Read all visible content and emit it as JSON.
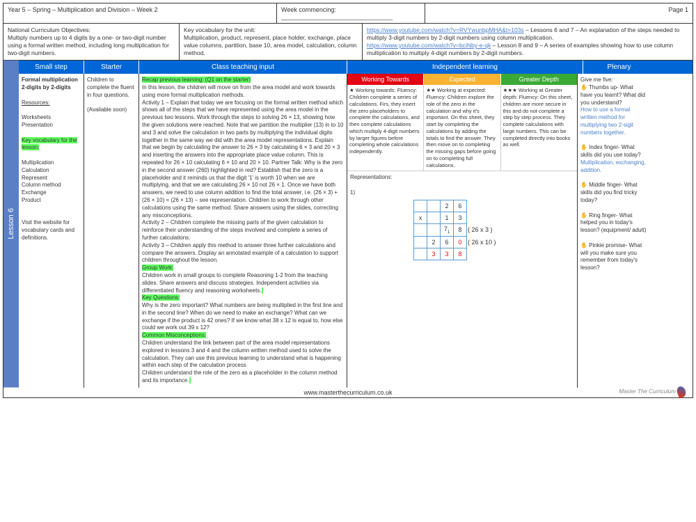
{
  "header": {
    "title": "Year 5 – Spring – Multiplication and Division – Week 2",
    "week": "Week commencing: ________________________________",
    "page": "Page 1"
  },
  "objectives": {
    "label": "National Curriculum Objectives:",
    "text": "Multiply numbers up to 4 digits by a one- or two-digit number using a formal written method, including long multiplication for two-digit numbers."
  },
  "vocab": {
    "label": "Key vocabulary for the unit:",
    "text": "Multiplication, product, represent, place holder, exchange, place value columns, partition, base 10,  area model,  calculation, column method."
  },
  "links": {
    "l1": "https://www.youtube.com/watch?v=RVYwunbpMHA&t=103s",
    "l1t": " – Lessons 6 and 7 – An explanation of the steps needed to multiply 3-digit numbers by 2-digit numbers using column multiplication.",
    "l2": "https://www.youtube.com/watch?v=bciNby-e-qk",
    "l2t": " – Lesson 8 and 9 – A series of examples showing how to use column multiplication to multiply 4-digit numbers by 2-digit numbers."
  },
  "lesson": "Lesson 6",
  "cols": {
    "c1": "Small step",
    "c2": "Starter",
    "c3": "Class teaching input",
    "c4": "Independent learning",
    "c5": "Plenary"
  },
  "smallstep": {
    "title": "Formal multiplication 2-digits by 2-digits",
    "res": "Resources:",
    "res1": "Worksheets",
    "res2": "Presentation",
    "kv": "Key vocabulary for the lesson:",
    "kvlist": "Multiplication\nCalculation\nRepresent\nColumn method\nExchange\nProduct",
    "note": "Visit the website for vocabulary cards and definitions."
  },
  "starter": {
    "text": "Children to complete the fluent in four questions.",
    "note": "(Available soon)"
  },
  "input": {
    "recap": "Recap previous learning: (Q1 on the starter)",
    "p1": "In this lesson, the children will move on from the area model and work towards using more formal multiplication methods.",
    "p2": "Activity 1 – Explain that today we are focusing on the formal written method which shows all of the steps that we have represented using the area model in the previous two lessons. Work through the steps to solving 26 × 13, showing how the given solutions were reached. Note that we partition the multiplier (13) in to 10 and 3 and solve the calculation in two parts by multiplying the individual digits together in the same way we did with the area model representations. Explain that we begin by calculating the answer to 26 × 3 by calculating 6 × 3 and 20 × 3 and inserting the answers into the appropriate place value column. This is repeated for 26 × 10 calculating 6 × 10 and 20 × 10. Partner Talk: Why is the zero in the second answer (260) highlighted in red? Establish that the zero is a placeholder and it reminds us that the digit '1' is worth 10 when we are multiplying, and that we are calculating 26 × 10 not 26 × 1. Once we have both answers, we need to use column addition to find the total answer, i.e. (26 × 3) + (26 × 10) = (26 × 13) – see representation. Children to work through other calculations using the same method. Share answers  using the slides, correcting any misconceptions.",
    "p3": "Activity 2 – Children complete the missing parts of the given calculation to reinforce their understanding of the steps involved and complete a series of further calculations.",
    "p4": "Activity 3 – Children apply this method to answer three further calculations and compare the answers. Display an annotated example of a calculation to support children throughout the lesson.",
    "gw": "Group Work:",
    "gwt": "Children work in small groups to complete Reasoning 1-2 from the teaching slides. Share answers and discuss strategies. Independent activities via differentiated fluency and reasoning worksheets.",
    "kq": "Key Questions:",
    "kqt": "Why is the zero important? What numbers are being multiplied in the first line and in the second line? When do we need to make an exchange? What can we exchange if the product is 42 ones? If we know what 38 x 12 is equal to, how else could we work out 39 x 12?",
    "cm": "Common Misconceptions:",
    "cmt": "Children understand the link between part of the area model representations explored in lessons 3 and 4 and the column written method used to solve the calculation. They can use this previous learning to understand what is happening within each step of the calculation process",
    "cmt2": "Children understand the role of the zero  as a placeholder in the column method and its importance."
  },
  "sub": {
    "wt": "Working Towards",
    "ex": "Expected",
    "gd": "Greater Depth"
  },
  "wt": "★ Working towards: Fluency: Children complete a series of calculations. Firs, they insert the zero placeholders to complete the calculations, and then complete calculations which multiply 4-digit numbers by larger figures before completing whole calculations independently.",
  "ex": "★★ Working at expected: Fluency: Children explore the role of the zero in the calculation and why it's important. On this sheet, they start by completing the calculations by adding the totals to find the answer. They then move on to completing the missing gaps before going on to completing full calculations.",
  "gd": "★★★ Working at Greater depth: Fluency: On this sheet, children are more secure in this and do not complete a step by step process. They complete calculations with large numbers. This can be completed directly into books as well.",
  "rep": "Representations:",
  "rep1": "1)",
  "mult": {
    "ann1": "( 26 x 3 )",
    "ann2": "( 26 x 10 )"
  },
  "plenary": {
    "t": "Give me five:",
    "p1": "✋ Thumbs up- What have you learnt? What did you understand?",
    "p1b": "How to use a formal written method for multiplying two 2-sigit numbers together.",
    "p2": "✋ Index finger- What skills did you use today?",
    "p2b": "Multiplication, exchanging, addition.",
    "p3": "✋ Middle finger- What skills did you find tricky today?",
    "p4": "✋ Ring finger- What helped you in today's lesson? (equipment/ adult)",
    "p5": "✋ Pinkie promise- What will you make sure you remember from today's lesson?"
  },
  "footer": "www.masterthecurriculum.co.uk",
  "brand": "Master The Curriculum"
}
